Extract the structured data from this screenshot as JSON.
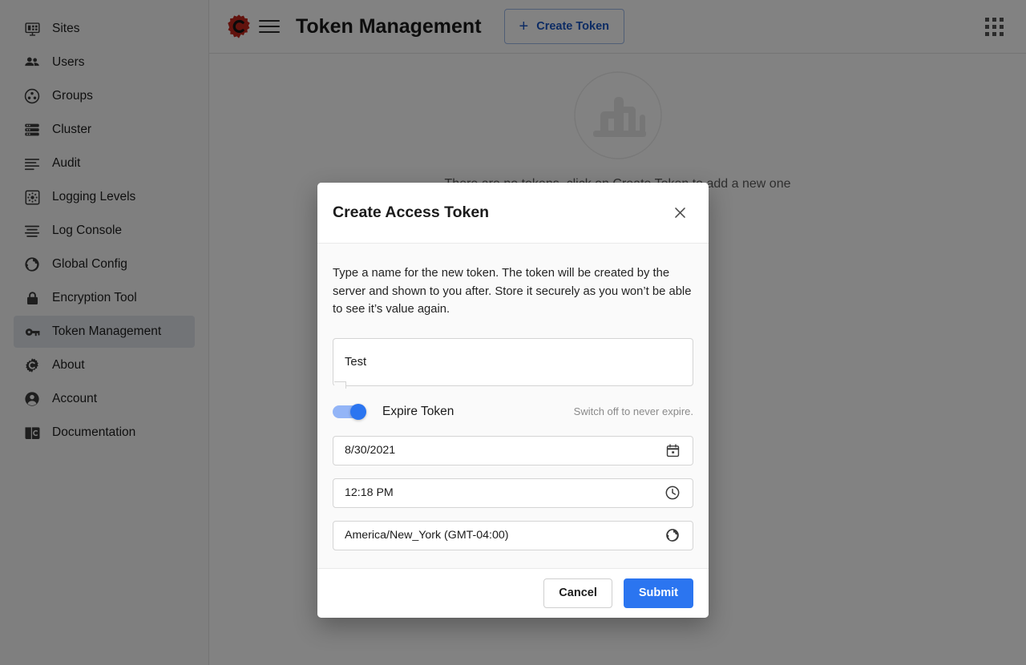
{
  "sidebar": {
    "items": [
      {
        "label": "Sites",
        "icon": "monitor-sites-icon",
        "active": false
      },
      {
        "label": "Users",
        "icon": "users-icon",
        "active": false
      },
      {
        "label": "Groups",
        "icon": "groups-icon",
        "active": false
      },
      {
        "label": "Cluster",
        "icon": "cluster-icon",
        "active": false
      },
      {
        "label": "Audit",
        "icon": "audit-list-icon",
        "active": false
      },
      {
        "label": "Logging Levels",
        "icon": "gear-square-icon",
        "active": false
      },
      {
        "label": "Log Console",
        "icon": "log-lines-icon",
        "active": false
      },
      {
        "label": "Global Config",
        "icon": "globe-icon",
        "active": false
      },
      {
        "label": "Encryption Tool",
        "icon": "lock-icon",
        "active": false
      },
      {
        "label": "Token Management",
        "icon": "key-icon",
        "active": true
      },
      {
        "label": "About",
        "icon": "gear-c-icon",
        "active": false
      },
      {
        "label": "Account",
        "icon": "person-circle-icon",
        "active": false
      },
      {
        "label": "Documentation",
        "icon": "book-c-icon",
        "active": false
      }
    ]
  },
  "topbar": {
    "logo_icon": "gear-c-logo-icon",
    "menu_icon": "hamburger-menu-icon",
    "title": "Token Management",
    "create_button": {
      "label": "Create Token",
      "icon": "plus-icon"
    },
    "apps_icon": "apps-grid-icon"
  },
  "main": {
    "empty_state": {
      "illustration": "empty-box-illustration",
      "text": "There are no tokens, click on Create Token to add a new one"
    }
  },
  "modal": {
    "title": "Create Access Token",
    "close_icon": "close-icon",
    "description": "Type a name for the new token. The token will be created by the server and shown to you after. Store it securely as you won’t be able to see it’s value again.",
    "name_input": {
      "value": "Test",
      "placeholder": ""
    },
    "expire_toggle": {
      "label": "Expire Token",
      "state": "on",
      "hint": "Switch off to never expire."
    },
    "date_field": {
      "value": "8/30/2021",
      "icon": "calendar-icon"
    },
    "time_field": {
      "value": "12:18 PM",
      "icon": "clock-icon"
    },
    "timezone_field": {
      "value": "America/New_York (GMT-04:00)",
      "icon": "globe-icon"
    },
    "cancel_button": "Cancel",
    "submit_button": "Submit"
  },
  "colors": {
    "accent_blue": "#2b75f0",
    "link_blue": "#1a56c4",
    "logo_red": "#c0271c",
    "active_nav_bg": "#dfe3ea",
    "overlay": "rgba(0,0,0,0.49)"
  }
}
